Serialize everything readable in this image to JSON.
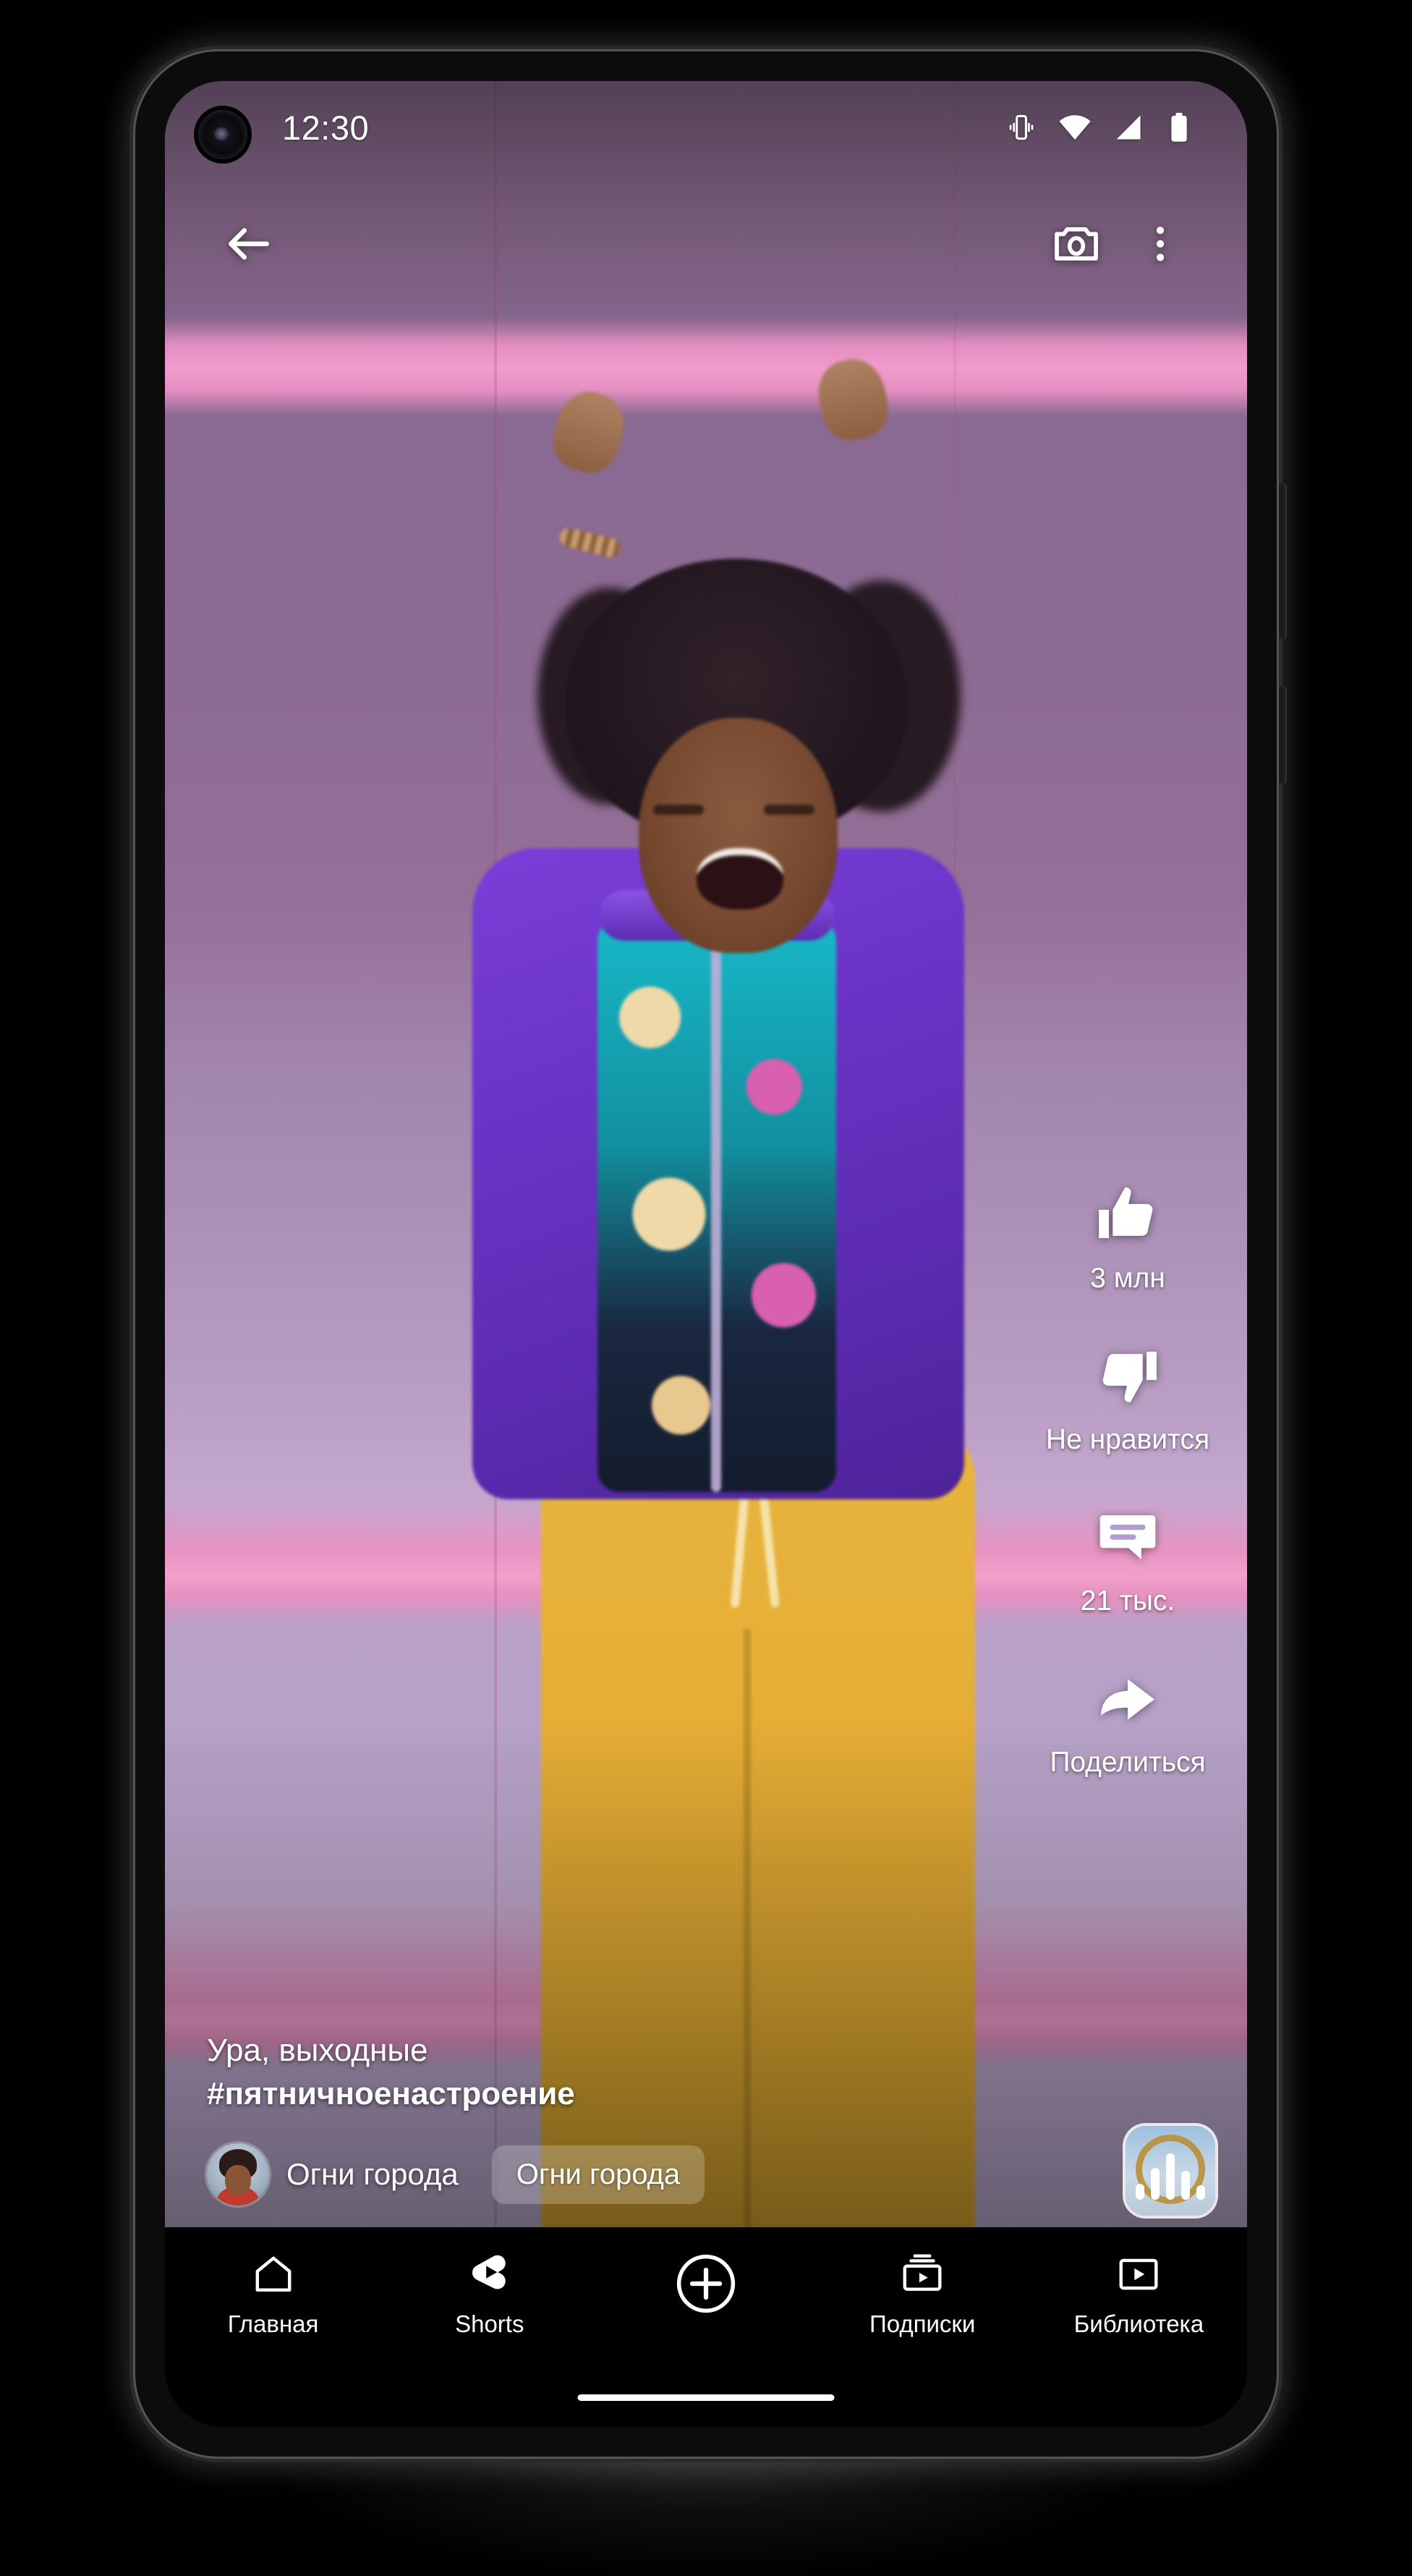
{
  "status_bar": {
    "time": "12:30",
    "icons": [
      "vibrate-icon",
      "wifi-icon",
      "signal-icon",
      "battery-icon"
    ]
  },
  "top_bar": {
    "back": "back-arrow-icon",
    "camera": "camera-icon",
    "more": "more-vertical-icon"
  },
  "actions": {
    "like": {
      "icon": "thumbs-up-icon",
      "label": "3 млн"
    },
    "dislike": {
      "icon": "thumbs-down-icon",
      "label": "Не нравится"
    },
    "comment": {
      "icon": "comment-icon",
      "label": "21 тыс."
    },
    "share": {
      "icon": "share-arrow-icon",
      "label": "Поделиться"
    }
  },
  "video_meta": {
    "caption": "Ура, выходные",
    "hashtag": "#пятничноенастроение",
    "channel": "Огни города",
    "sound": "Огни города",
    "avatar": "channel-avatar",
    "sound_disc": "sound-disc-thumbnail"
  },
  "bottom_nav": [
    {
      "label": "Главная",
      "icon": "home-icon"
    },
    {
      "label": "Shorts",
      "icon": "shorts-icon"
    },
    {
      "label": "",
      "icon": "create-plus-icon"
    },
    {
      "label": "Подписки",
      "icon": "subscriptions-icon"
    },
    {
      "label": "Библиотека",
      "icon": "library-icon"
    }
  ],
  "colors": {
    "nav_background": "#000000",
    "text": "#ffffff",
    "chip_background": "rgba(255,255,255,0.22)",
    "wall": "#8e6f93",
    "stripe": "#ef9ccb",
    "jacket": "#6a33c6",
    "pants": "#e8b53f"
  }
}
